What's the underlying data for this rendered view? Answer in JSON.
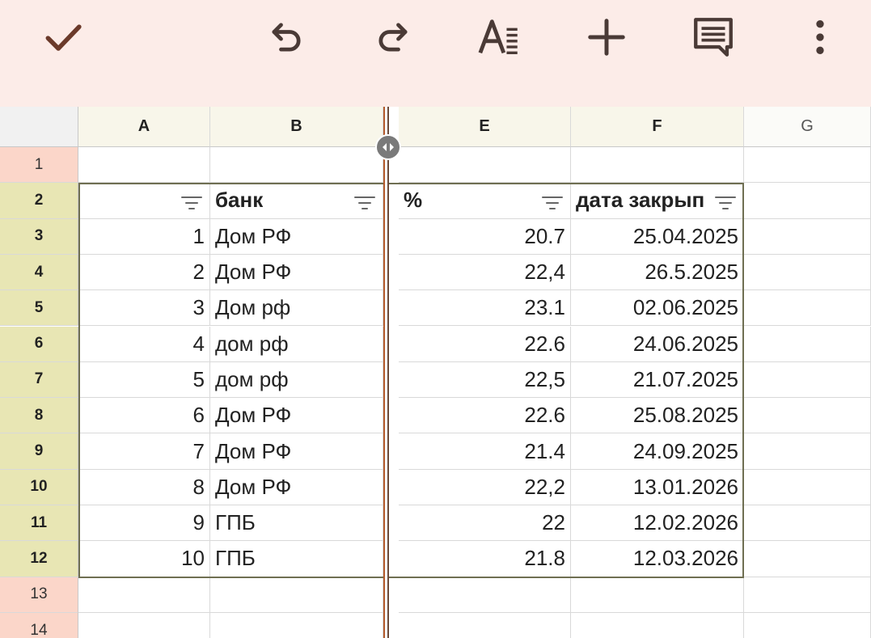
{
  "toolbar": {
    "icons": [
      "check-icon",
      "undo-icon",
      "redo-icon",
      "text-format-icon",
      "add-icon",
      "comment-icon",
      "more-vert-icon"
    ],
    "accent_color": "#6b3a2a",
    "background": "#fcece8"
  },
  "columns": [
    "A",
    "B",
    "E",
    "F",
    "G"
  ],
  "rows": [
    "1",
    "2",
    "3",
    "4",
    "5",
    "6",
    "7",
    "8",
    "9",
    "10",
    "11",
    "12",
    "13",
    "14"
  ],
  "table": {
    "headers": {
      "a": "",
      "b": "банк",
      "e": "%",
      "f": "дата закрып"
    },
    "rows": [
      {
        "a": "1",
        "b": "Дом РФ",
        "e": "20.7",
        "f": "25.04.2025"
      },
      {
        "a": "2",
        "b": "Дом РФ",
        "e": "22,4",
        "f": "26.5.2025"
      },
      {
        "a": "3",
        "b": "Дом рф",
        "e": "23.1",
        "f": "02.06.2025"
      },
      {
        "a": "4",
        "b": "дом рф",
        "e": "22.6",
        "f": "24.06.2025"
      },
      {
        "a": "5",
        "b": "дом рф",
        "e": "22,5",
        "f": "21.07.2025"
      },
      {
        "a": "6",
        "b": "Дом РФ",
        "e": "22.6",
        "f": "25.08.2025"
      },
      {
        "a": "7",
        "b": "Дом РФ",
        "e": "21.4",
        "f": "24.09.2025"
      },
      {
        "a": "8",
        "b": "Дом РФ",
        "e": "22,2",
        "f": "13.01.2026"
      },
      {
        "a": "9",
        "b": "ГПБ",
        "e": "22",
        "f": "12.02.2026"
      },
      {
        "a": "10",
        "b": "ГПБ",
        "e": "21.8",
        "f": "12.03.2026"
      }
    ]
  },
  "colors": {
    "selected_row_header": "#e8e6b4",
    "row_header": "#fbd6c9",
    "column_header": "#f8f6ea",
    "freeze_line": "#b45a2c"
  }
}
